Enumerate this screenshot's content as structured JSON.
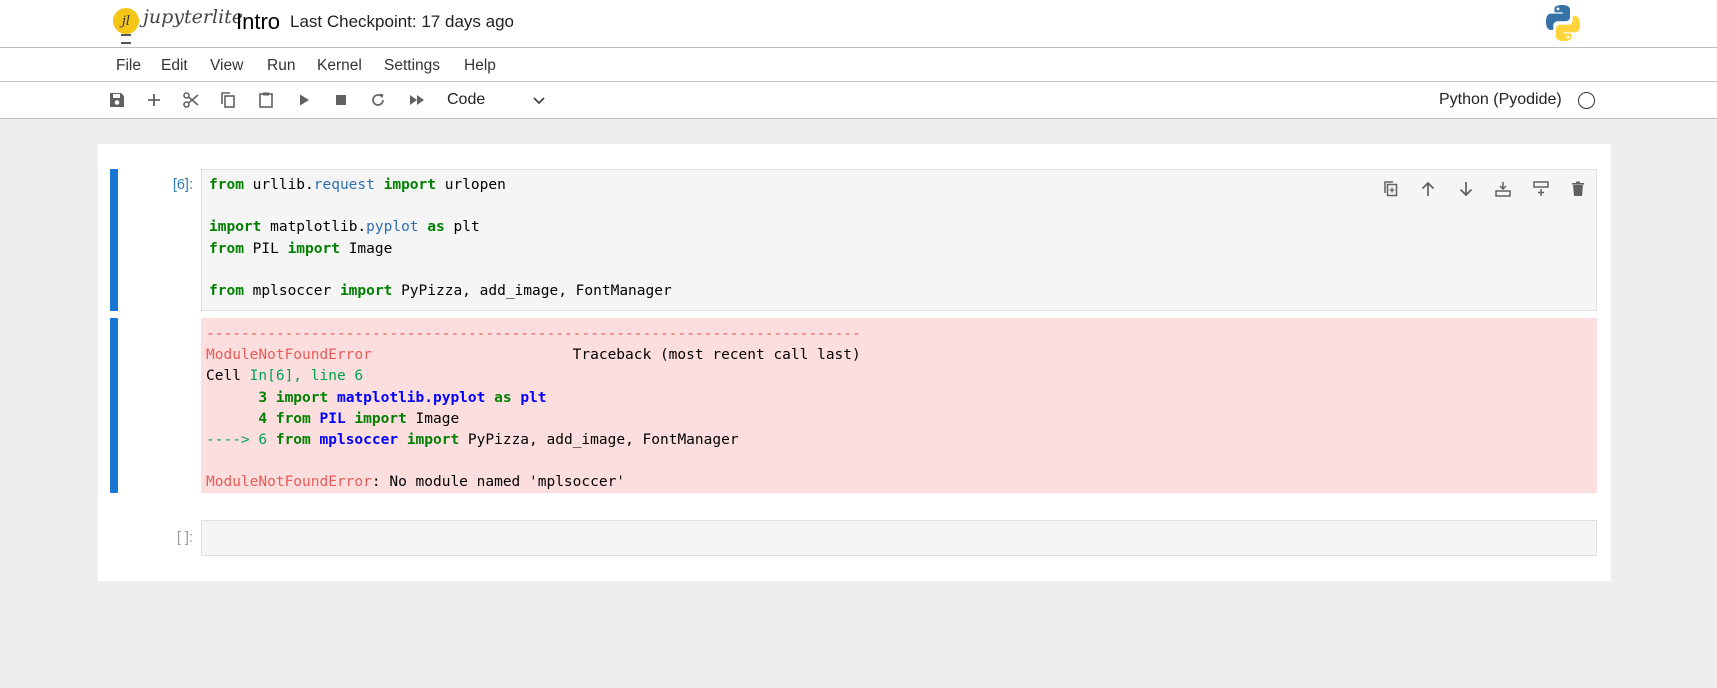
{
  "header": {
    "logo_mark": "jl",
    "logo_text": "jupyterlite",
    "notebook_title": "Intro",
    "checkpoint_text": "Last Checkpoint: 17 days ago",
    "kernel_logo_icon": "python-logo-icon"
  },
  "menu": [
    "File",
    "Edit",
    "View",
    "Run",
    "Kernel",
    "Settings",
    "Help"
  ],
  "toolbar": {
    "buttons": [
      "save-icon",
      "add-icon",
      "cut-icon",
      "copy-icon",
      "paste-icon",
      "run-icon",
      "stop-icon",
      "restart-icon",
      "fast-forward-icon"
    ],
    "cell_type": "Code",
    "kernel_name": "Python (Pyodide)",
    "kernel_status_icon": "kernel-idle-circle-icon"
  },
  "cells": [
    {
      "prompt": "[6]:",
      "code_lines": [
        [
          [
            "kw",
            "from"
          ],
          [
            "",
            " urllib."
          ],
          [
            "attr",
            "request"
          ],
          [
            "",
            " "
          ],
          [
            "kw",
            "import"
          ],
          [
            "",
            " urlopen"
          ]
        ],
        [],
        [
          [
            "kw",
            "import"
          ],
          [
            "",
            " matplotlib."
          ],
          [
            "attr",
            "pyplot"
          ],
          [
            "",
            " "
          ],
          [
            "kw",
            "as"
          ],
          [
            "",
            " plt"
          ]
        ],
        [
          [
            "kw",
            "from"
          ],
          [
            "",
            " PIL "
          ],
          [
            "kw",
            "import"
          ],
          [
            "",
            " Image"
          ]
        ],
        [],
        [
          [
            "kw",
            "from"
          ],
          [
            "",
            " mplsoccer "
          ],
          [
            "kw",
            "import"
          ],
          [
            "",
            " PyPizza, add_image, FontManager"
          ]
        ]
      ],
      "actions": [
        "duplicate-icon",
        "move-up-icon",
        "move-down-icon",
        "insert-above-icon",
        "insert-below-icon",
        "delete-icon"
      ],
      "output": {
        "lines": [
          [
            [
              "red",
              "---------------------------------------------------------------------------"
            ]
          ],
          [
            [
              "red",
              "ModuleNotFoundError"
            ],
            [
              "",
              "                       Traceback (most recent call last)"
            ]
          ],
          [
            [
              "",
              "Cell "
            ],
            [
              "green",
              "In[6], line 6"
            ]
          ],
          [
            [
              "gb",
              "      3"
            ],
            [
              "",
              " "
            ],
            [
              "gb",
              "import"
            ],
            [
              "",
              " "
            ],
            [
              "bb",
              "matplotlib.pyplot"
            ],
            [
              "",
              " "
            ],
            [
              "gb",
              "as"
            ],
            [
              "",
              " "
            ],
            [
              "bb",
              "plt"
            ]
          ],
          [
            [
              "gb",
              "      4"
            ],
            [
              "",
              " "
            ],
            [
              "gb",
              "from"
            ],
            [
              "",
              " "
            ],
            [
              "bb",
              "PIL"
            ],
            [
              "",
              " "
            ],
            [
              "gb",
              "import"
            ],
            [
              "",
              " Image"
            ]
          ],
          [
            [
              "green",
              "----> 6"
            ],
            [
              "",
              " "
            ],
            [
              "gb",
              "from"
            ],
            [
              "",
              " "
            ],
            [
              "bb",
              "mplsoccer"
            ],
            [
              "",
              " "
            ],
            [
              "gb",
              "import"
            ],
            [
              "",
              " PyPizza, add_image, FontManager"
            ]
          ],
          [],
          [
            [
              "red",
              "ModuleNotFoundError"
            ],
            [
              "",
              ": No module named 'mplsoccer'"
            ]
          ]
        ]
      }
    },
    {
      "prompt": "[ ]:",
      "code_lines": []
    }
  ]
}
